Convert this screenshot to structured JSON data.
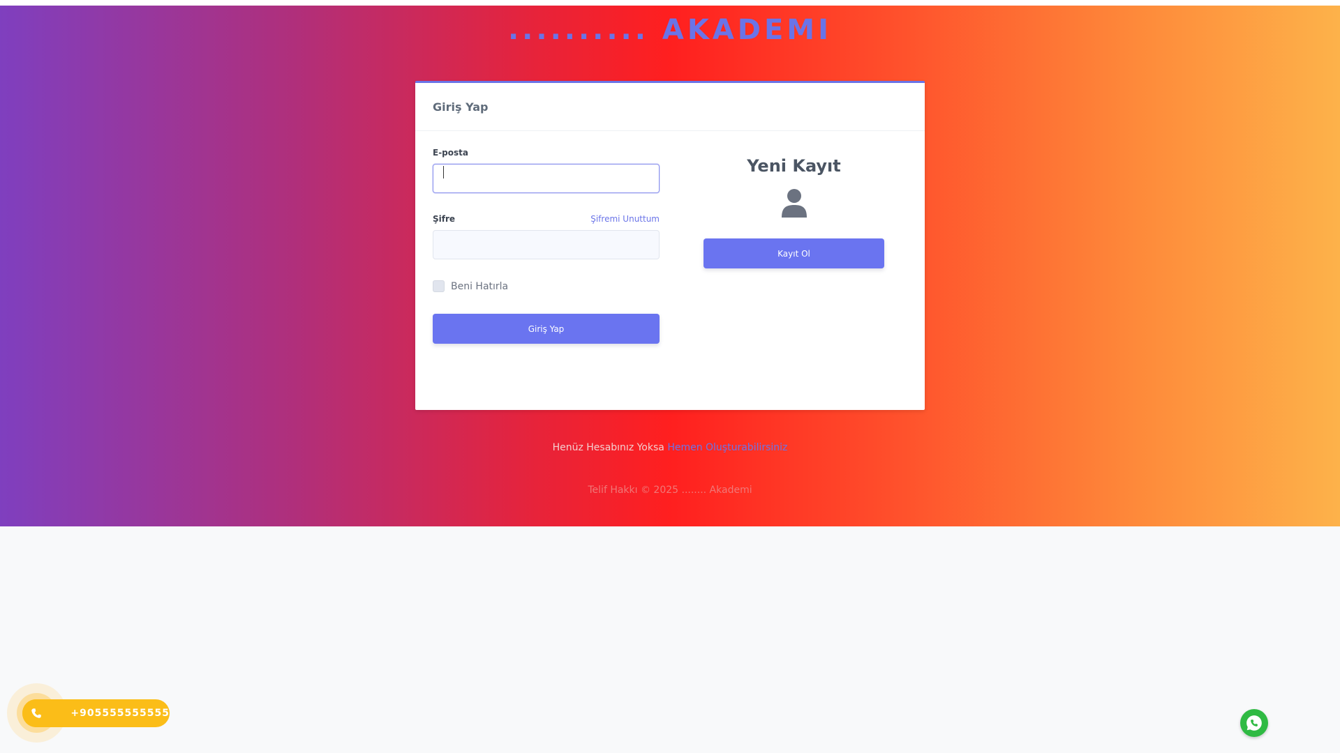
{
  "brand": {
    "title": ".......... AKADEMI"
  },
  "login": {
    "header": "Giriş Yap",
    "email_label": "E-posta",
    "email_value": "",
    "password_label": "Şifre",
    "forgot_link": "Şifremi Unuttum",
    "remember_label": "Beni Hatırla",
    "submit_label": "Giriş Yap"
  },
  "register": {
    "title": "Yeni Kayıt",
    "icon": "user-icon",
    "button_label": "Kayıt Ol"
  },
  "footer": {
    "prompt": "Henüz Hesabınız Yoksa",
    "link": "Hemen Oluşturabilirsiniz",
    "copyright": "Telif Hakkı © 2025 ........ Akademi"
  },
  "contact": {
    "phone": "+905555555555",
    "phone_icon": "phone-icon",
    "whatsapp_icon": "whatsapp-icon"
  },
  "colors": {
    "accent": "#6a74f0",
    "phone_pill": "#fbbd18",
    "whatsapp": "#2fba43"
  }
}
